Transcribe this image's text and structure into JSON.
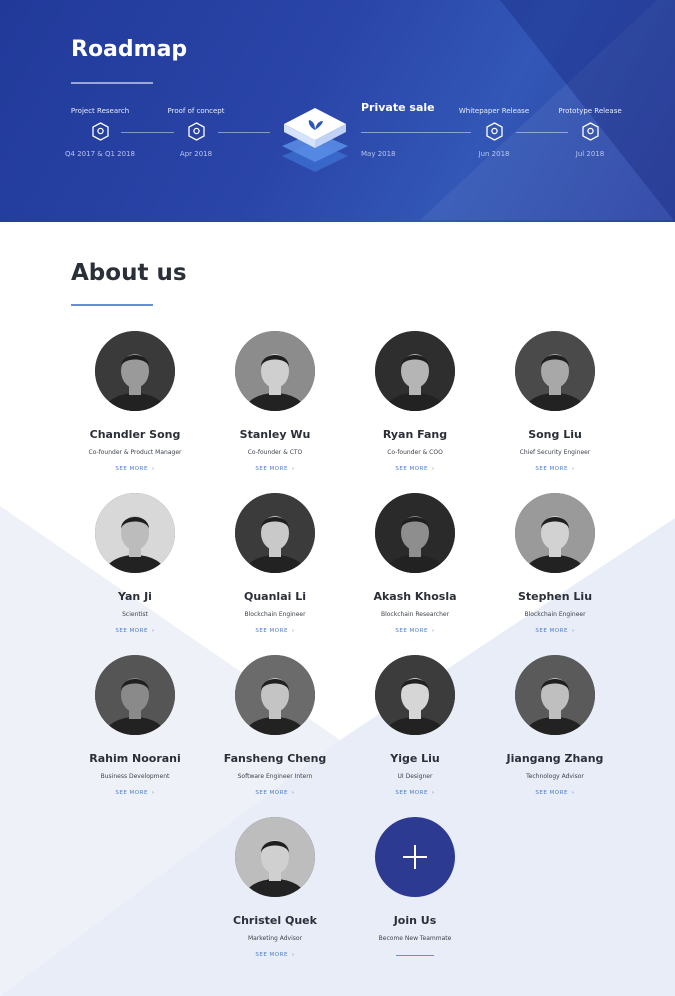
{
  "roadmap": {
    "title": "Roadmap",
    "milestones": [
      {
        "label": "Project Research",
        "date": "Q4 2017 & Q1 2018"
      },
      {
        "label": "Proof of concept",
        "date": "Apr 2018"
      },
      {
        "label": "Whitepaper Release",
        "date": "Jun 2018"
      },
      {
        "label": "Prototype Release",
        "date": "Jul 2018"
      }
    ],
    "current": {
      "label": "Private sale",
      "date": "May 2018"
    }
  },
  "about": {
    "title": "About us",
    "see_more": "SEE MORE",
    "members": [
      {
        "name": "Chandler Song",
        "role": "Co-founder & Product Manager"
      },
      {
        "name": "Stanley Wu",
        "role": "Co-founder & CTO"
      },
      {
        "name": "Ryan Fang",
        "role": "Co-founder & COO"
      },
      {
        "name": "Song Liu",
        "role": "Chief Security Engineer"
      },
      {
        "name": "Yan Ji",
        "role": "Scientist"
      },
      {
        "name": "Quanlai Li",
        "role": "Blockchain Engineer"
      },
      {
        "name": "Akash Khosla",
        "role": "Blockchain Researcher"
      },
      {
        "name": "Stephen  Liu",
        "role": "Blockchain Engineer"
      },
      {
        "name": "Rahim Noorani",
        "role": "Business Development"
      },
      {
        "name": "Fansheng Cheng",
        "role": "Software Engineer Intern"
      },
      {
        "name": "Yige Liu",
        "role": "UI Designer"
      },
      {
        "name": "Jiangang Zhang",
        "role": "Technology Advisor"
      },
      {
        "name": "Christel Quek",
        "role": "Marketing Advisor"
      }
    ],
    "join": {
      "title": "Join Us",
      "subtitle": "Become New Teammate"
    }
  }
}
